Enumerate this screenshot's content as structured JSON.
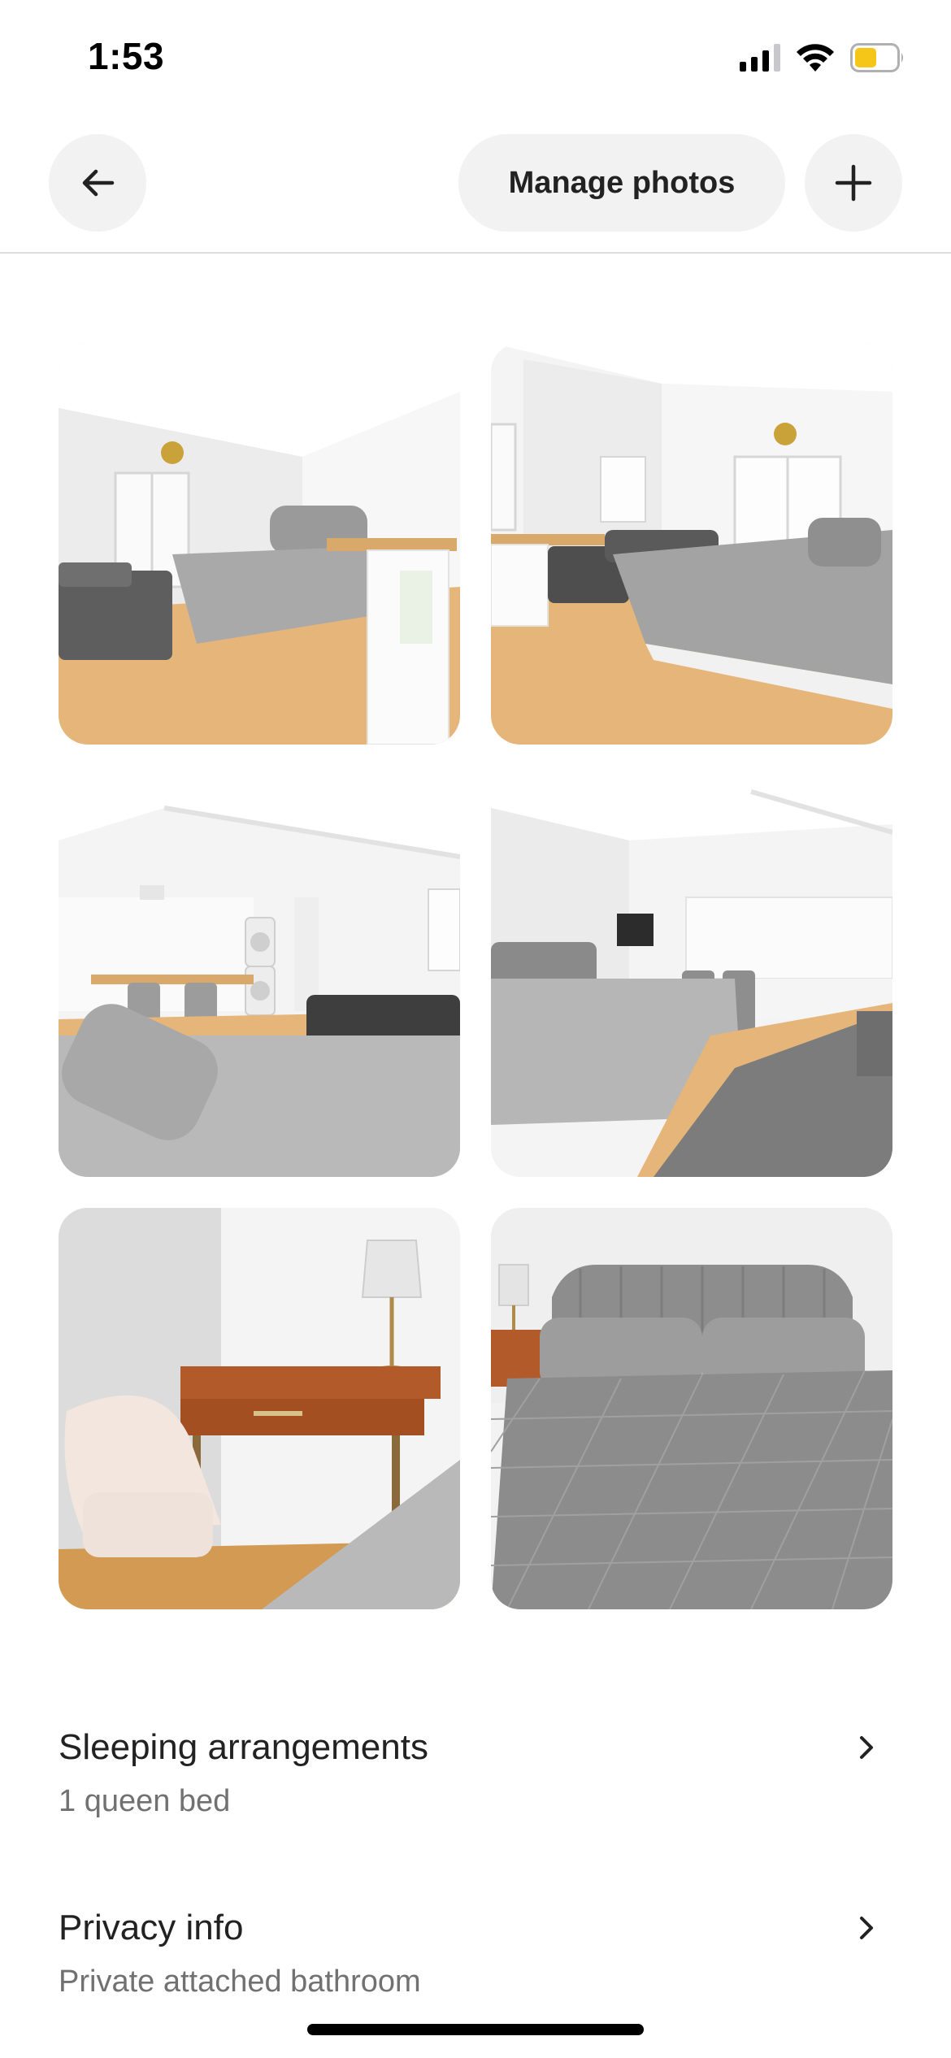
{
  "status_bar": {
    "time": "1:53",
    "icons": [
      "cellular-signal-icon",
      "wifi-icon",
      "battery-icon"
    ],
    "battery_color": "#f5c518"
  },
  "header": {
    "back_icon": "arrow-left-icon",
    "manage_photos_label": "Manage photos",
    "add_icon": "plus-icon"
  },
  "photos": [
    {
      "subject": "bedroom with french doors, sofa and desk"
    },
    {
      "subject": "bedroom with bed, sofa and french doors"
    },
    {
      "subject": "studio with kitchen, washer dryer, bed and sofa"
    },
    {
      "subject": "bed facing kitchen and dining area"
    },
    {
      "subject": "accent chair, wooden desk and lamp"
    },
    {
      "subject": "queen bed with grey headboard"
    }
  ],
  "sections": {
    "sleeping": {
      "title": "Sleeping arrangements",
      "subtitle": "1 queen bed"
    },
    "privacy": {
      "title": "Privacy info",
      "subtitle": "Private attached bathroom"
    }
  },
  "colors": {
    "text_primary": "#222222",
    "text_secondary": "#717171",
    "button_bg": "#f2f2f2",
    "divider": "#dddddd"
  }
}
